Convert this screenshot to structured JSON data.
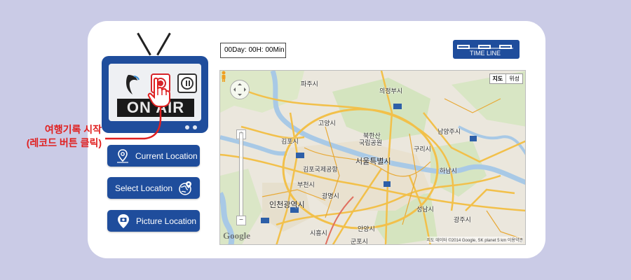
{
  "tv": {
    "status_text": "ON AIR",
    "record_icon": "record-icon",
    "pause_icon": "pause-icon",
    "logo_icon": "feather-logo-icon"
  },
  "annotation": {
    "line1": "여행기록 시작",
    "line2": "(레코드 버튼 클릭)",
    "color": "#e02020"
  },
  "buttons": [
    {
      "label": "Current Location",
      "icon": "location-pin-icon"
    },
    {
      "label": "Select Location",
      "icon": "globe-pin-icon"
    },
    {
      "label": "Picture Location",
      "icon": "photo-pin-icon"
    }
  ],
  "timer": {
    "text": "00Day: 00H: 00Min"
  },
  "timeline": {
    "label": "TIME LINE"
  },
  "map": {
    "type_map": "지도",
    "type_satellite": "위성",
    "attribution": "지도 데이터 ©2014 Google, SK planet   5 km  이용약관",
    "logo": "Google",
    "labels": {
      "paju": "파주시",
      "uijeongbu": "의정부시",
      "goyang": "고양시",
      "bukhansan": "북한산",
      "national_park": "국립공원",
      "namyangju": "남양주시",
      "gimpo": "김포시",
      "guri": "구리시",
      "gimpo_airport": "김포국제공항",
      "seoul": "서울특별시",
      "hanam": "하남시",
      "bucheon": "부천시",
      "gwangmyeong": "광명시",
      "incheon": "인천광역시",
      "seongnam": "성남시",
      "gwangju": "광주시",
      "siheung": "시흥시",
      "anyang": "안양시",
      "gunpo": "군포시"
    }
  },
  "colors": {
    "brand": "#1f4d9c",
    "record": "#d6242a",
    "background": "#cacbe6"
  }
}
